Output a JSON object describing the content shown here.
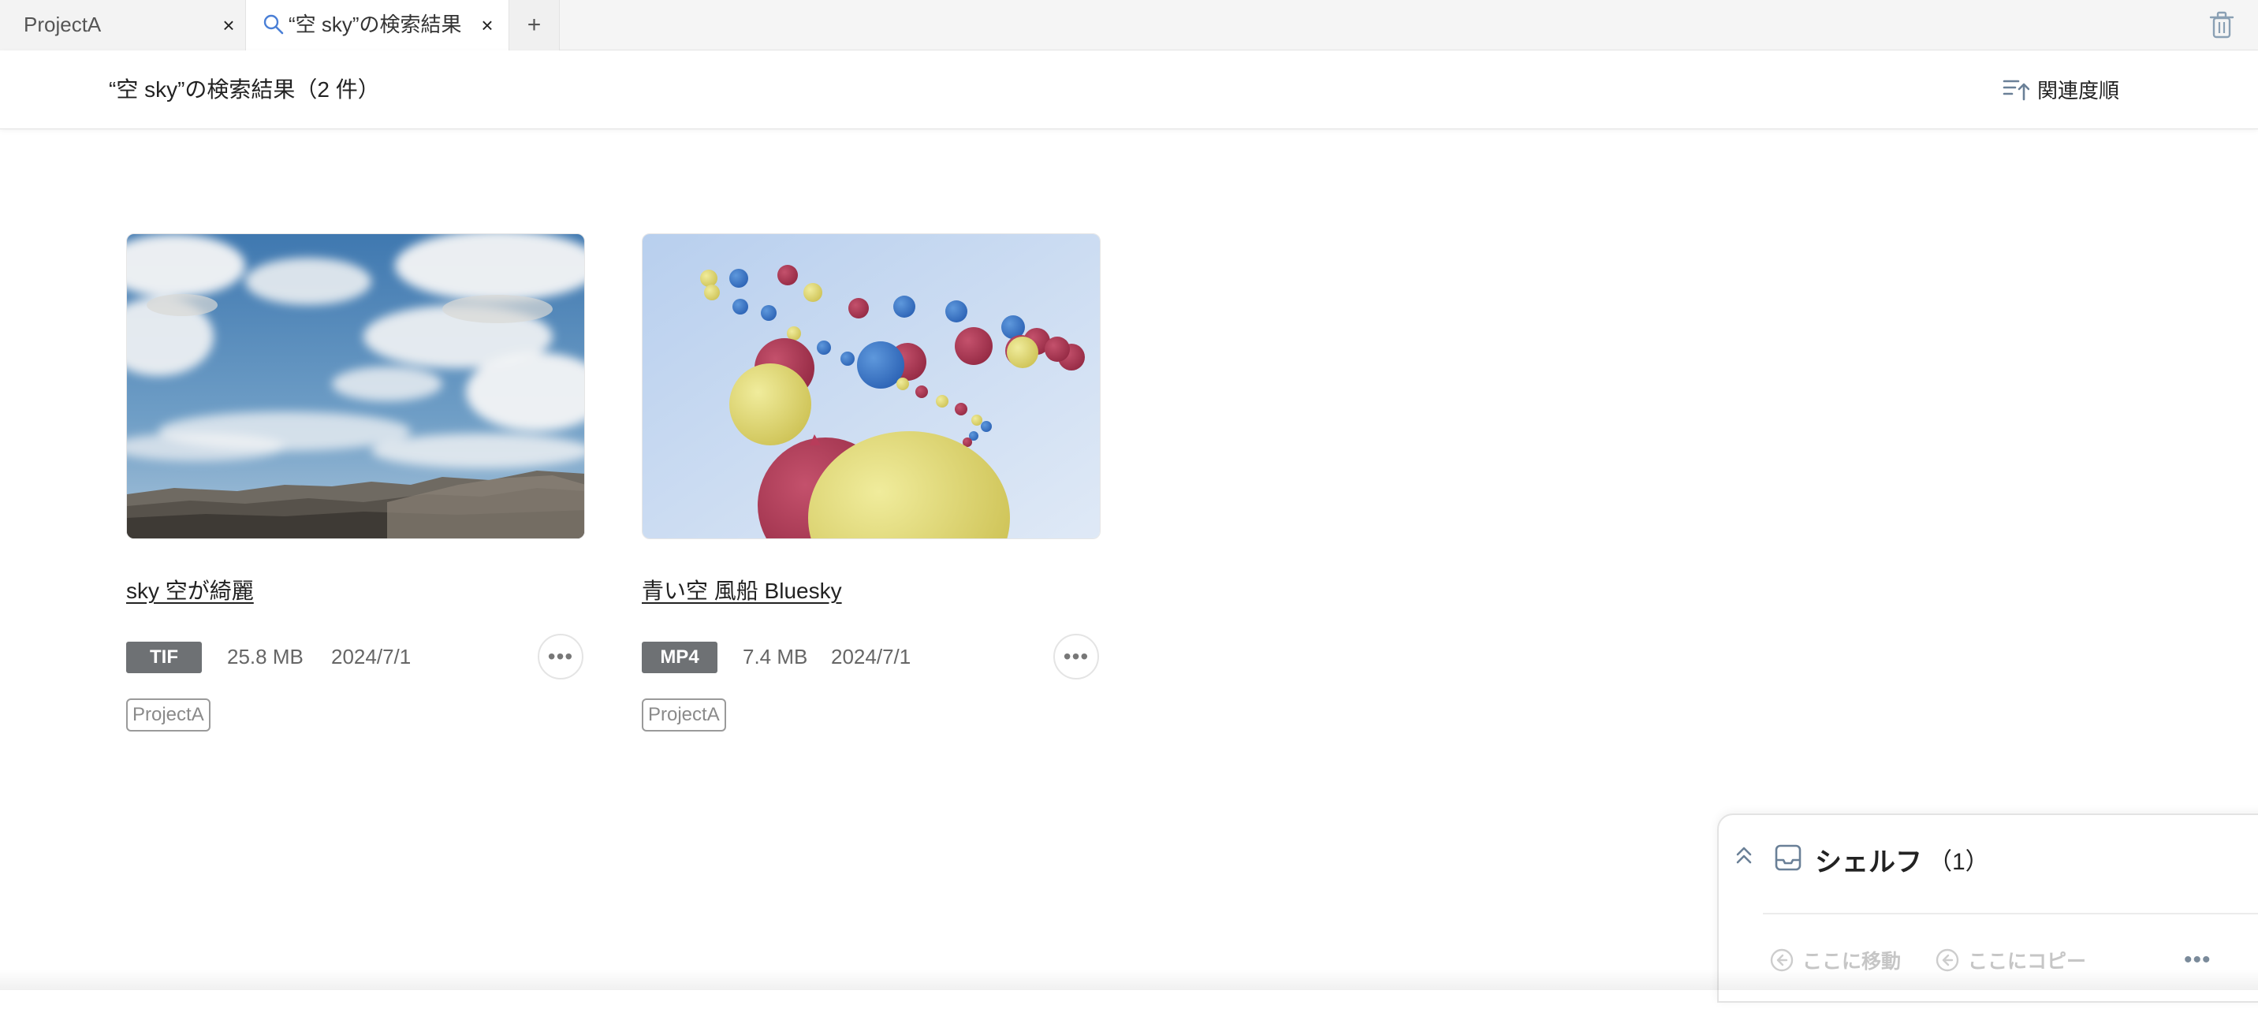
{
  "tabs": [
    {
      "label": "ProjectA",
      "close": "×"
    },
    {
      "label": "“空 sky”の検索結果",
      "close": "×"
    }
  ],
  "tab_add": "+",
  "header": {
    "title": "“空 sky”の検索結果（2 件）",
    "sort_label": "関連度順"
  },
  "items": [
    {
      "title": "sky 空が綺麗",
      "format": "TIF",
      "size": "25.8 MB",
      "date": "2024/7/1",
      "project": "ProjectA",
      "more": "•••"
    },
    {
      "title": "青い空 風船 Bluesky",
      "format": "MP4",
      "size": "7.4 MB",
      "date": "2024/7/1",
      "project": "ProjectA",
      "more": "•••"
    }
  ],
  "shelf": {
    "title": "シェルフ",
    "count": "（1）",
    "move_label": "ここに移動",
    "copy_label": "ここにコピー",
    "more": "•••"
  },
  "colors": {
    "accent": "#4a7fd6",
    "badge": "#6e7174"
  }
}
